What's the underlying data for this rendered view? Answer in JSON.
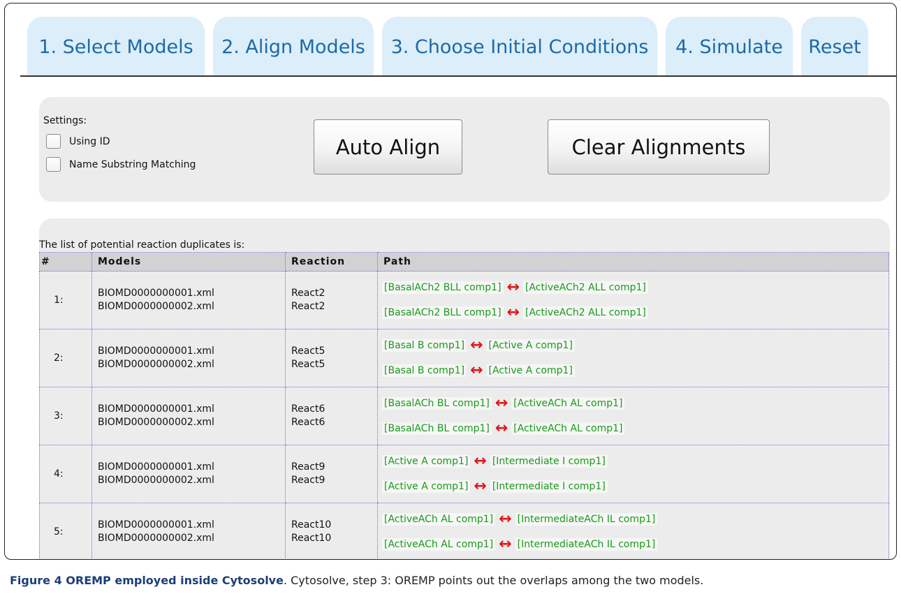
{
  "tabs": [
    {
      "label": "1. Select Models"
    },
    {
      "label": "2. Align Models"
    },
    {
      "label": "3. Choose Initial Conditions"
    },
    {
      "label": "4. Simulate"
    },
    {
      "label": "Reset"
    }
  ],
  "settings": {
    "title": "Settings:",
    "using_id_label": "Using ID",
    "using_id_checked": false,
    "name_substring_label": "Name Substring Matching",
    "name_substring_checked": false,
    "auto_align_label": "Auto Align",
    "clear_alignments_label": "Clear Alignments"
  },
  "results": {
    "caption": "The list of potential reaction duplicates is:",
    "columns": [
      "#",
      "Models",
      "Reaction",
      "Path"
    ],
    "rows": [
      {
        "index": "1:",
        "models": [
          "BIOMD0000000001.xml",
          "BIOMD0000000002.xml"
        ],
        "reactions": [
          "React2",
          "React2"
        ],
        "paths": [
          [
            "[BasalACh2 BLL comp1]",
            "[ActiveACh2 ALL comp1]"
          ],
          [
            "[BasalACh2 BLL comp1]",
            "[ActiveACh2 ALL comp1]"
          ]
        ]
      },
      {
        "index": "2:",
        "models": [
          "BIOMD0000000001.xml",
          "BIOMD0000000002.xml"
        ],
        "reactions": [
          "React5",
          "React5"
        ],
        "paths": [
          [
            "[Basal B comp1]",
            "[Active A comp1]"
          ],
          [
            "[Basal B comp1]",
            "[Active A comp1]"
          ]
        ]
      },
      {
        "index": "3:",
        "models": [
          "BIOMD0000000001.xml",
          "BIOMD0000000002.xml"
        ],
        "reactions": [
          "React6",
          "React6"
        ],
        "paths": [
          [
            "[BasalACh BL comp1]",
            "[ActiveACh AL comp1]"
          ],
          [
            "[BasalACh BL comp1]",
            "[ActiveACh AL comp1]"
          ]
        ]
      },
      {
        "index": "4:",
        "models": [
          "BIOMD0000000001.xml",
          "BIOMD0000000002.xml"
        ],
        "reactions": [
          "React9",
          "React9"
        ],
        "paths": [
          [
            "[Active A comp1]",
            "[Intermediate I comp1]"
          ],
          [
            "[Active A comp1]",
            "[Intermediate I comp1]"
          ]
        ]
      },
      {
        "index": "5:",
        "models": [
          "BIOMD0000000001.xml",
          "BIOMD0000000002.xml"
        ],
        "reactions": [
          "React10",
          "React10"
        ],
        "paths": [
          [
            "[ActiveACh AL comp1]",
            "[IntermediateACh IL comp1]"
          ],
          [
            "[ActiveACh AL comp1]",
            "[IntermediateACh IL comp1]"
          ]
        ]
      }
    ],
    "arrow_icon": "double-arrow-icon",
    "arrow_color": "#e01818",
    "path_text_color": "#1a9a1a"
  },
  "caption": {
    "bold": "Figure 4 OREMP employed inside Cytosolve",
    "text": ". Cytosolve, step 3: OREMP points out the overlaps among the two models."
  }
}
